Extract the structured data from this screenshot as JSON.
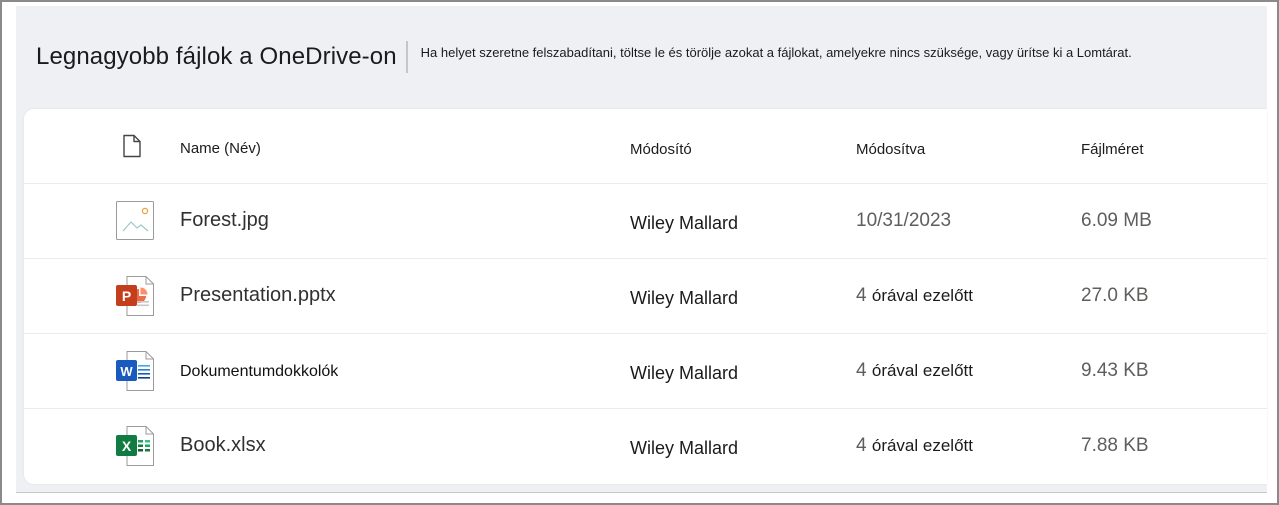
{
  "header": {
    "title": "Legnagyobb fájlok a OneDrive-on",
    "subtitle": "Ha helyet szeretne felszabadítani, töltse le és törölje azokat a fájlokat, amelyekre nincs szüksége, vagy ürítse ki a Lomtárat."
  },
  "table": {
    "columns": {
      "name": "Name (Név)",
      "modifier": "Módosító",
      "modified": "Módosítva",
      "size": "Fájlméret"
    },
    "rows": [
      {
        "icon": "image-file-icon",
        "name": "Forest.jpg",
        "modifier": "Wiley Mallard",
        "modified_num": "",
        "modified_text": "10/31/2023",
        "size": "6.09 MB"
      },
      {
        "icon": "powerpoint-file-icon",
        "name": "Presentation.pptx",
        "modifier": "Wiley Mallard",
        "modified_num": "4",
        "modified_text": "órával ezelőtt",
        "size": "27.0 KB"
      },
      {
        "icon": "word-file-icon",
        "name": "Dokumentumdokkolók",
        "modifier": "Wiley Mallard",
        "modified_num": "4",
        "modified_text": "órával ezelőtt",
        "size": "9.43 KB"
      },
      {
        "icon": "excel-file-icon",
        "name": "Book.xlsx",
        "modifier": "Wiley Mallard",
        "modified_num": "4",
        "modified_text": "órával ezelőtt",
        "size": "7.88 KB"
      }
    ]
  },
  "colors": {
    "panel_bg": "#eef0f4",
    "powerpoint": "#c43e1c",
    "word": "#185abd",
    "excel": "#107c41"
  }
}
